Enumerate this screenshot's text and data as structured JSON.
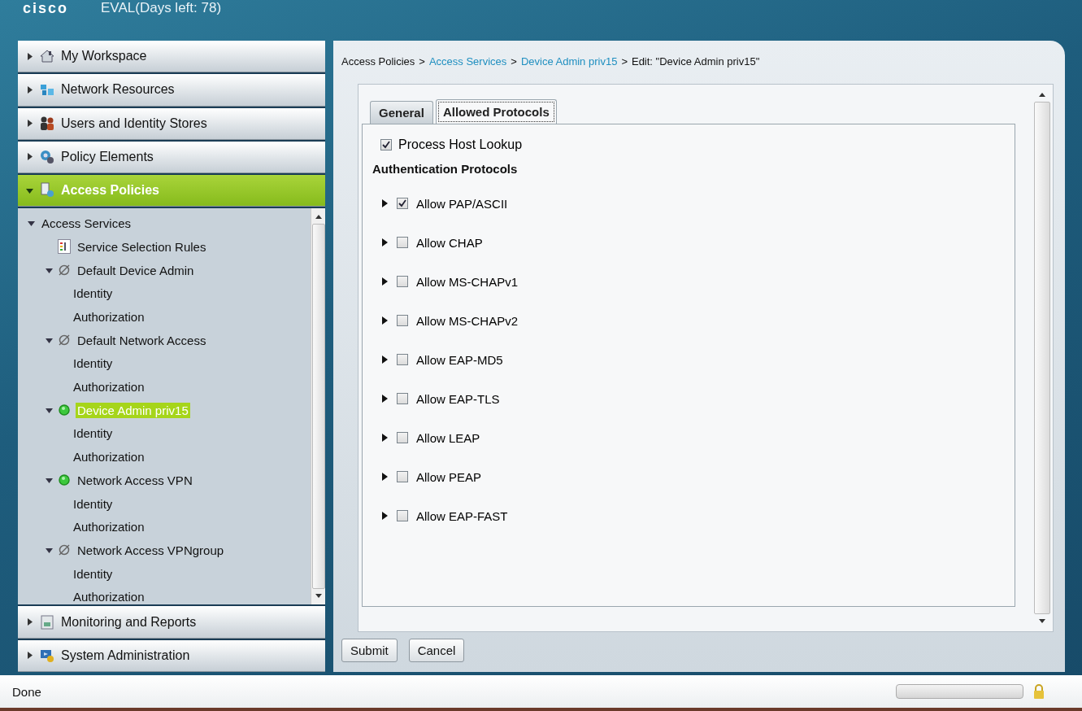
{
  "header": {
    "logo": "cisco",
    "title": "EVAL(Days left: 78)"
  },
  "sidebar": {
    "sections": [
      {
        "label": "My Workspace",
        "selected": false,
        "expanded": false
      },
      {
        "label": "Network Resources",
        "selected": false,
        "expanded": false
      },
      {
        "label": "Users and Identity Stores",
        "selected": false,
        "expanded": false
      },
      {
        "label": "Policy Elements",
        "selected": false,
        "expanded": false
      },
      {
        "label": "Access Policies",
        "selected": true,
        "expanded": true,
        "tree": [
          {
            "label": "Access Services",
            "selected": false,
            "expanded": true,
            "children": [
              {
                "label": "Service Selection Rules",
                "kind": "rules",
                "selected": false
              },
              {
                "label": "Default Device Admin",
                "kind": "disabled",
                "selected": false,
                "expanded": true,
                "children": [
                  {
                    "label": "Identity",
                    "selected": false
                  },
                  {
                    "label": "Authorization",
                    "selected": false
                  }
                ]
              },
              {
                "label": "Default Network Access",
                "kind": "disabled",
                "selected": false,
                "expanded": true,
                "children": [
                  {
                    "label": "Identity",
                    "selected": false
                  },
                  {
                    "label": "Authorization",
                    "selected": false
                  }
                ]
              },
              {
                "label": "Device Admin priv15",
                "kind": "enabled",
                "selected": true,
                "expanded": true,
                "children": [
                  {
                    "label": "Identity",
                    "selected": false
                  },
                  {
                    "label": "Authorization",
                    "selected": false
                  }
                ]
              },
              {
                "label": "Network Access VPN",
                "kind": "enabled",
                "selected": false,
                "expanded": true,
                "children": [
                  {
                    "label": "Identity",
                    "selected": false
                  },
                  {
                    "label": "Authorization",
                    "selected": false
                  }
                ]
              },
              {
                "label": "Network Access VPNgroup",
                "kind": "disabled",
                "selected": false,
                "expanded": true,
                "children": [
                  {
                    "label": "Identity",
                    "selected": false
                  },
                  {
                    "label": "Authorization",
                    "selected": false
                  }
                ]
              }
            ]
          }
        ]
      },
      {
        "label": "Monitoring and Reports",
        "selected": false,
        "expanded": false
      },
      {
        "label": "System Administration",
        "selected": false,
        "expanded": false
      }
    ]
  },
  "content": {
    "breadcrumb": [
      {
        "text": "Access Policies",
        "kind": "plain"
      },
      {
        "text": ">",
        "kind": "separator"
      },
      {
        "text": "Access Services",
        "kind": "link"
      },
      {
        "text": ">",
        "kind": "separator"
      },
      {
        "text": "Device Admin priv15",
        "kind": "link"
      },
      {
        "text": ">",
        "kind": "separator"
      },
      {
        "text": "Edit: \"Device Admin priv15\"",
        "kind": "plain"
      }
    ],
    "tabs": [
      {
        "label": "General",
        "selected": false
      },
      {
        "label": "Allowed Protocols",
        "selected": true
      }
    ],
    "options": [
      {
        "label": "Process Host Lookup",
        "checked": true
      }
    ],
    "section_title": "Authentication Protocols",
    "protocols": [
      {
        "label": "Allow PAP/ASCII",
        "checked": true,
        "expanded": false
      },
      {
        "label": "Allow CHAP",
        "checked": false,
        "expanded": false
      },
      {
        "label": "Allow MS-CHAPv1",
        "checked": false,
        "expanded": false
      },
      {
        "label": "Allow MS-CHAPv2",
        "checked": false,
        "expanded": false
      },
      {
        "label": "Allow EAP-MD5",
        "checked": false,
        "expanded": false
      },
      {
        "label": "Allow EAP-TLS",
        "checked": false,
        "expanded": false
      },
      {
        "label": "Allow LEAP",
        "checked": false,
        "expanded": false
      },
      {
        "label": "Allow PEAP",
        "checked": false,
        "expanded": false
      },
      {
        "label": "Allow EAP-FAST",
        "checked": false,
        "expanded": false
      }
    ],
    "buttons": [
      "Submit",
      "Cancel"
    ]
  },
  "status_bar": {
    "text": "Done",
    "progress": {
      "level": 0
    }
  }
}
